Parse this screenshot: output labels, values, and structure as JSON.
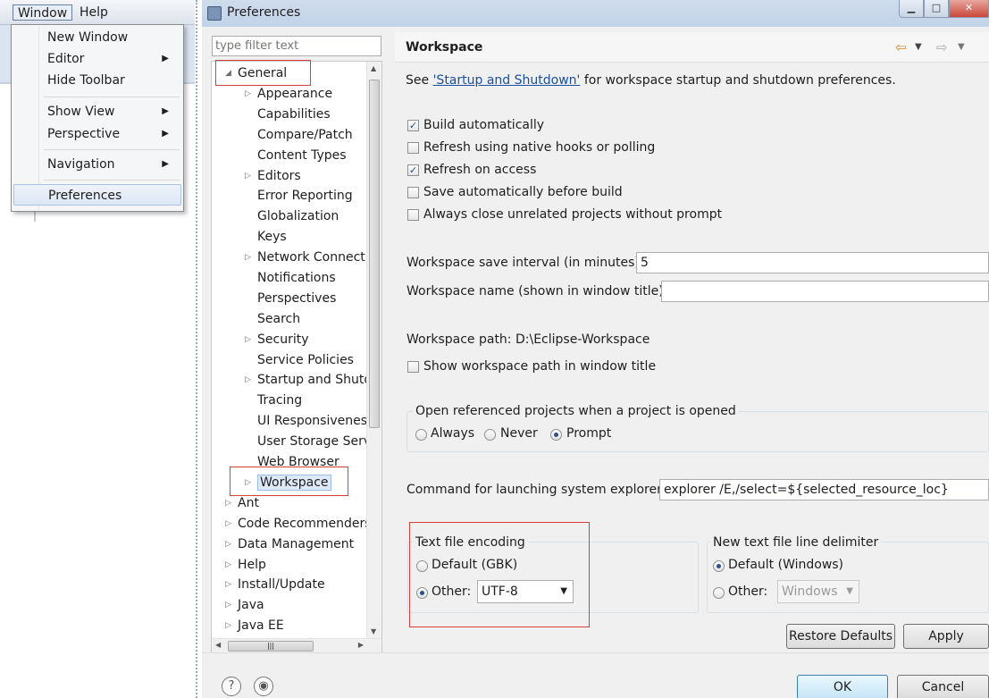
{
  "menubar": {
    "window": "Window",
    "help": "Help"
  },
  "window_menu": {
    "new_window": "New Window",
    "editor": "Editor",
    "hide_toolbar": "Hide Toolbar",
    "show_view": "Show View",
    "perspective": "Perspective",
    "navigation": "Navigation",
    "preferences": "Preferences"
  },
  "dialog": {
    "title": "Preferences"
  },
  "filter": {
    "placeholder": "type filter text"
  },
  "tree": {
    "general": "General",
    "general_children": [
      "Appearance",
      "Capabilities",
      "Compare/Patch",
      "Content Types",
      "Editors",
      "Error Reporting",
      "Globalization",
      "Keys",
      "Network Connecti",
      "Notifications",
      "Perspectives",
      "Search",
      "Security",
      "Service Policies",
      "Startup and Shutd",
      "Tracing",
      "UI Responsiveness",
      "User Storage Serv",
      "Web Browser",
      "Workspace"
    ],
    "top_level": [
      "Ant",
      "Code Recommenders",
      "Data Management",
      "Help",
      "Install/Update",
      "Java",
      "Java EE"
    ]
  },
  "page": {
    "title": "Workspace",
    "see_prefix": "See ",
    "see_link": "'Startup and Shutdown'",
    "see_suffix": " for workspace startup and shutdown preferences.",
    "build_automatically": "Build automatically",
    "refresh_native": "Refresh using native hooks or polling",
    "refresh_access": "Refresh on access",
    "save_before_build": "Save automatically before build",
    "always_close": "Always close unrelated projects without prompt",
    "save_interval_label": "Workspace save interval (in minutes):",
    "save_interval_value": "5",
    "workspace_name_label": "Workspace name (shown in window title):",
    "workspace_name_value": "",
    "workspace_path_label": "Workspace path:",
    "workspace_path_value": "D:\\Eclipse-Workspace",
    "show_path": "Show workspace path in window title",
    "open_ref_group": "Open referenced projects when a project is opened",
    "always": "Always",
    "never": "Never",
    "prompt": "Prompt",
    "explorer_label": "Command for launching system explorer:",
    "explorer_value": "explorer /E,/select=${selected_resource_loc}",
    "encoding_group": "Text file encoding",
    "default_gbk": "Default (GBK)",
    "other": "Other:",
    "encoding_value": "UTF-8",
    "delimiter_group": "New text file line delimiter",
    "default_windows": "Default (Windows)",
    "delimiter_other": "Other:",
    "delimiter_value": "Windows",
    "restore_defaults": "Restore Defaults",
    "apply": "Apply"
  },
  "buttons": {
    "ok": "OK",
    "cancel": "Cancel"
  },
  "state": {
    "build_automatically": true,
    "refresh_native": false,
    "refresh_access": true,
    "save_before_build": false,
    "always_close": false,
    "show_path": false,
    "open_ref": "Prompt",
    "encoding": "Other",
    "delimiter": "Default"
  }
}
